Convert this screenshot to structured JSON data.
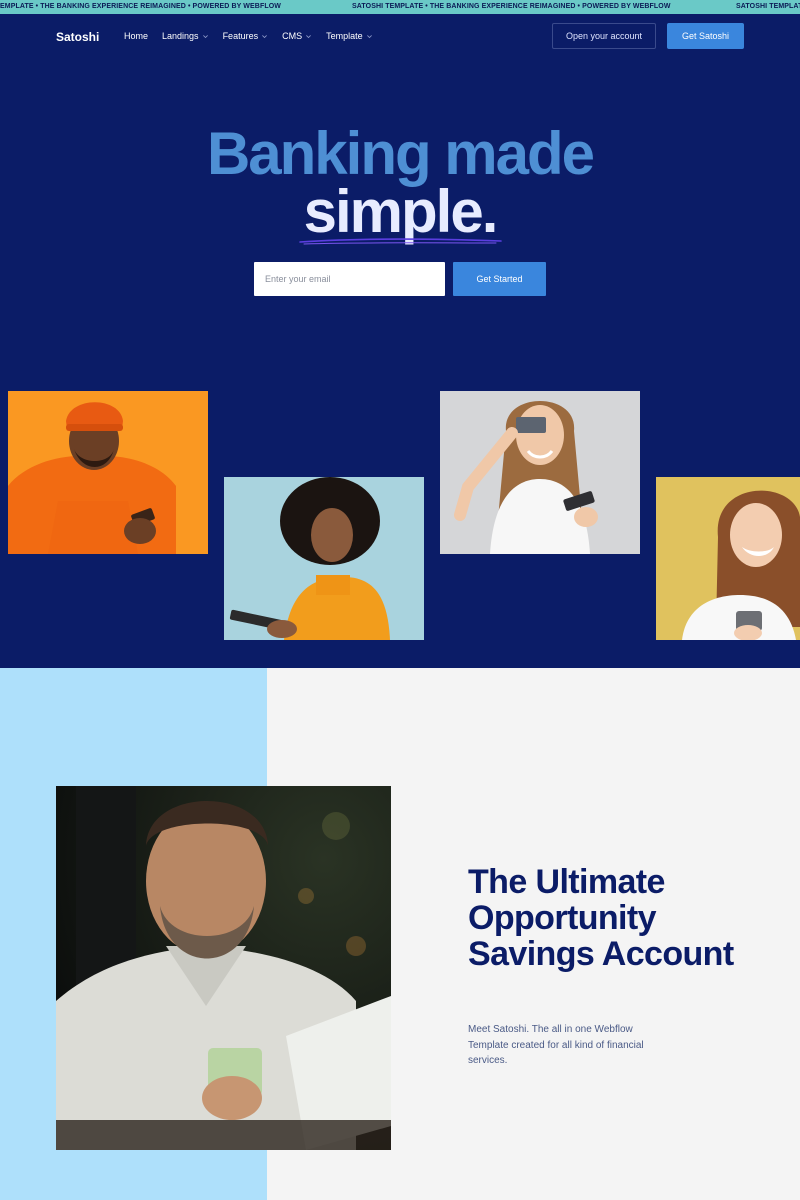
{
  "ticker": {
    "segments": [
      "EMPLATE • THE BANKING EXPERIENCE REIMAGINED • POWERED BY WEBFLOW",
      "SATOSHI TEMPLATE • THE BANKING EXPERIENCE REIMAGINED • POWERED BY WEBFLOW",
      "SATOSHI TEMPLATE •"
    ]
  },
  "header": {
    "logo": "Satoshi",
    "nav": [
      {
        "label": "Home",
        "dropdown": false
      },
      {
        "label": "Landings",
        "dropdown": true
      },
      {
        "label": "Features",
        "dropdown": true
      },
      {
        "label": "CMS",
        "dropdown": true
      },
      {
        "label": "Template",
        "dropdown": true
      }
    ],
    "open_account_label": "Open your account",
    "get_label": "Get Satoshi"
  },
  "hero": {
    "headline_line1": "Banking made",
    "headline_line2": "simple.",
    "email_placeholder": "Enter your email",
    "cta_label": "Get Started",
    "photos": [
      {
        "name": "man-orange-hoodie-photo",
        "bg": "#f7941d"
      },
      {
        "name": "woman-curly-hair-photo",
        "bg": "#a9d3de"
      },
      {
        "name": "woman-holding-card-photo",
        "bg": "#d5d6d8"
      },
      {
        "name": "woman-smiling-phone-photo",
        "bg": "#e0c25e"
      }
    ]
  },
  "feature": {
    "title": "The Ultimate Opportunity Savings Account",
    "description": "Meet Satoshi. The all in one Webflow Template created for all kind of financial services."
  },
  "colors": {
    "hero_bg": "#0b1c67",
    "accent_blue": "#3a86dd",
    "headline_blue": "#4e8fd4",
    "ticker_teal": "#6ac9c7",
    "light_blue_band": "#aee0fb"
  }
}
